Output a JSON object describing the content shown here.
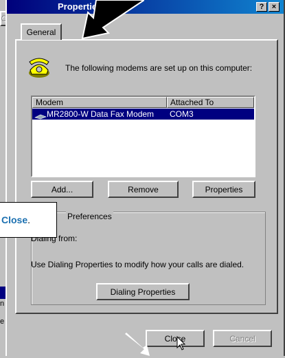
{
  "background_dialog": {
    "cancel_label": "Cancel",
    "side_texts": [
      "n",
      "e"
    ]
  },
  "window": {
    "title": "Properties",
    "help_symbol": "?",
    "close_symbol": "×"
  },
  "tab": {
    "label": "General"
  },
  "intro_text": "The following modems are set up on this computer:",
  "modem_list": {
    "columns": [
      "Modem",
      "Attached To"
    ],
    "rows": [
      {
        "modem": "MR2800-W Data Fax Modem",
        "attached_to": "COM3"
      }
    ]
  },
  "buttons": {
    "add": "Add...",
    "remove": "Remove",
    "properties": "Properties",
    "dialing_properties": "Dialing Properties",
    "close": "Close",
    "cancel": "Cancel"
  },
  "dialing_group": {
    "label": "Preferences",
    "dialing_from": "Dialing from:",
    "description": "Use Dialing Properties to modify how your calls are dialed."
  },
  "callout": {
    "text": "Close",
    "suffix": "."
  },
  "colors": {
    "titlebar": "#00007b",
    "selection": "#000080",
    "callout_text": "#1a6fb0"
  }
}
